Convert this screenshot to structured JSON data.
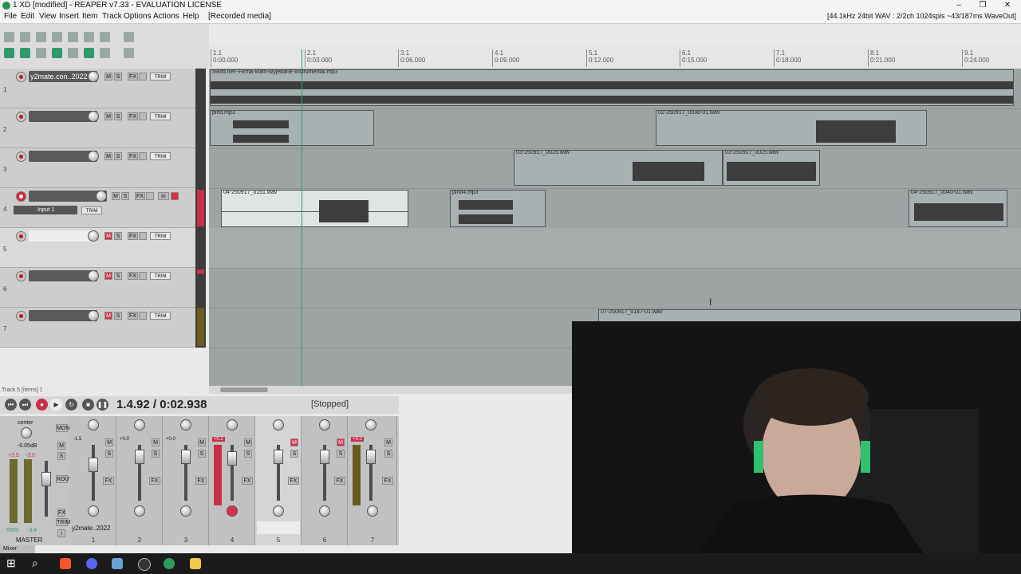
{
  "title_bar": {
    "title": "1 XD [modified] - REAPER v7.33 - EVALUATION LICENSE",
    "minimize": "–",
    "restore": "❐",
    "close": "✕"
  },
  "menu": {
    "items": [
      "File",
      "Edit",
      "View",
      "Insert",
      "Item",
      "Track",
      "Options",
      "Actions",
      "Help"
    ],
    "recorded_media": "[Recorded media]",
    "status": "[44.1kHz 24bit WAV : 2/2ch 1024spls ~43/187ms WaveOut]"
  },
  "ruler": {
    "marks": [
      {
        "bar": "1.1",
        "time": "0:00.000"
      },
      {
        "bar": "2.1",
        "time": "0:03.000"
      },
      {
        "bar": "3.1",
        "time": "0:06.000"
      },
      {
        "bar": "4.1",
        "time": "0:09.000"
      },
      {
        "bar": "5.1",
        "time": "0:12.000"
      },
      {
        "bar": "6.1",
        "time": "0:15.000"
      },
      {
        "bar": "7.1",
        "time": "0:18.000"
      },
      {
        "bar": "8.1",
        "time": "0:21.000"
      },
      {
        "bar": "9.1",
        "time": "0:24.000"
      }
    ]
  },
  "tracks": [
    {
      "num": "1",
      "name": "y2mate.con..2022"
    },
    {
      "num": "2",
      "name": ""
    },
    {
      "num": "3",
      "name": ""
    },
    {
      "num": "4",
      "name": "",
      "input": "Input 1",
      "in_label": "in"
    },
    {
      "num": "5",
      "name": ""
    },
    {
      "num": "6",
      "name": ""
    },
    {
      "num": "7",
      "name": ""
    }
  ],
  "track_buttons": {
    "mute": "M",
    "solo": "S",
    "fx": "FX",
    "trim": "TRIM"
  },
  "items": {
    "i1": "59vid.net--Firma-Mam-wyjebane-Instrumental.mp3",
    "i2": "pirlo.mp3",
    "i3": "02-250917_0038-01.wav",
    "i4": "03-250917_0025.wav",
    "i5": "03-250917_0025.wav",
    "i6": "04-250917_0151.wav",
    "i7": "pirlo4.mp3",
    "i8": "04-250917_0040-01.wav",
    "i9": "07-250917_0147-01.wav"
  },
  "status_small": "Track 5 [items] 1",
  "transport": {
    "time": "1.4.92 / 0:02.938",
    "state": "[Stopped]"
  },
  "mixer": {
    "master_label": "MASTER",
    "center": "center",
    "master_db": "-0.05dB",
    "master_peak": "+3.5",
    "master_peak2": "-3.0",
    "rms": "RMS",
    "rms_val": "-3.4",
    "side_buttons": [
      "MONO",
      "M",
      "S",
      "ROUTE",
      "FX",
      "TRIM"
    ],
    "info_icon": "i",
    "channel_name_1": "y2mate..2022",
    "channels": [
      {
        "num": "1",
        "vol": "-1.5"
      },
      {
        "num": "2",
        "vol": "+0.0"
      },
      {
        "num": "3",
        "vol": "+0.0"
      },
      {
        "num": "4",
        "vol": "+0.2"
      },
      {
        "num": "5",
        "vol": ""
      },
      {
        "num": "6",
        "vol": ""
      },
      {
        "num": "7",
        "vol": "+0.0"
      }
    ],
    "tab": "Mixer"
  },
  "colors": {
    "accent_green": "#25a56a",
    "record_red": "#d8304a"
  }
}
